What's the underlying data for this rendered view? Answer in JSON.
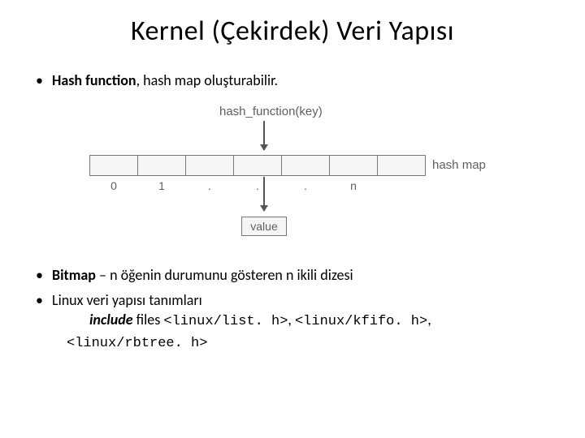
{
  "title": "Kernel (Çekirdek) Veri Yapısı",
  "bullets": {
    "b1_strong": "Hash function",
    "b1_rest": ", hash map oluşturabilir.",
    "b2_strong": "Bitmap",
    "b2_rest_a": " – ",
    "b2_rest_b": "n",
    "b2_rest_c": " öğenin durumunu gösteren n ikili dizesi",
    "b3_lead": "Linux veri yapısı tanımları",
    "b3_inc_strong": "include",
    "b3_inc_rest": " files ",
    "b3_code1": "<linux/list. h>",
    "b3_sep1": ", ",
    "b3_code2": "<linux/kfifo. h>",
    "b3_sep2": ",",
    "b3_code3": "<linux/rbtree. h>"
  },
  "diagram": {
    "hash_label": "hash_function(key)",
    "map_label": "hash map",
    "value_label": "value",
    "indices": [
      "0",
      "1",
      ".",
      ".",
      ".",
      "n",
      ""
    ]
  }
}
